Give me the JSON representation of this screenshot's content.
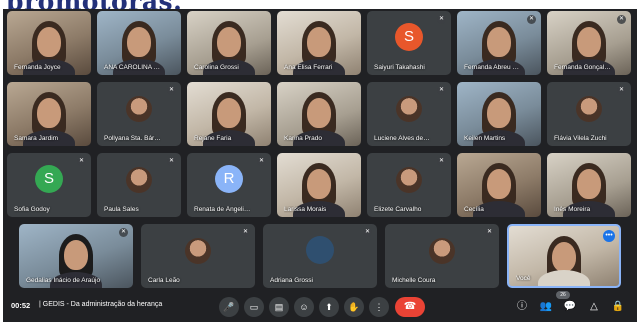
{
  "page_title_fragment": "promotoras.",
  "participants": [
    {
      "name": "Fernanda Joyce"
    },
    {
      "name": "ANA CAROLINA PA..."
    },
    {
      "name": "Carolina Grossi"
    },
    {
      "name": "Ana Elisa Ferrari"
    },
    {
      "name": "Saiyuri Takahashi",
      "initial": "S",
      "avatar_color": "#e8572b"
    },
    {
      "name": "Fernanda Abreu L..."
    },
    {
      "name": "Fernanda Gonçalv..."
    },
    {
      "name": "Samara Jardim"
    },
    {
      "name": "Pollyana Sta. Bárba..."
    },
    {
      "name": "Rejane Faria"
    },
    {
      "name": "Karina Prado"
    },
    {
      "name": "Luciene Alves de M..."
    },
    {
      "name": "Keilen Martins"
    },
    {
      "name": "Flávia Vilela Zuchi"
    },
    {
      "name": "Sofia Godoy",
      "initial": "S",
      "avatar_color": "#34a853"
    },
    {
      "name": "Paula Sales"
    },
    {
      "name": "Renata de Ângelis ...",
      "initial": "R",
      "avatar_color": "#8ab4f8"
    },
    {
      "name": "Larissa Morais"
    },
    {
      "name": "Elizete Carvalho"
    },
    {
      "name": "Cecília"
    },
    {
      "name": "Inês Moreira"
    },
    {
      "name": "Gedalias Inácio de Araújo"
    },
    {
      "name": "Carla Leão"
    },
    {
      "name": "Adriana Grossi"
    },
    {
      "name": "Michelle Coura"
    },
    {
      "name": "Você"
    }
  ],
  "bottom_bar": {
    "time": "00:52",
    "separator": "|",
    "meeting_name": "GEDIS - Da administração da herança",
    "participants_count": "26"
  },
  "colors": {
    "meet_background": "#202124",
    "tile_background": "#3c4043",
    "hangup": "#ea4335",
    "accent": "#1a73e8",
    "title_text": "#23317a"
  },
  "icons": {
    "mic": "mic-icon",
    "camera": "camera-icon",
    "captions": "captions-icon",
    "emoji": "emoji-icon",
    "present": "present-icon",
    "raise_hand": "hand-icon",
    "more": "more-vert-icon",
    "hangup": "call-end-icon",
    "info": "info-icon",
    "people": "people-icon",
    "chat": "chat-icon",
    "activities": "activities-icon",
    "lock": "lock-icon"
  }
}
